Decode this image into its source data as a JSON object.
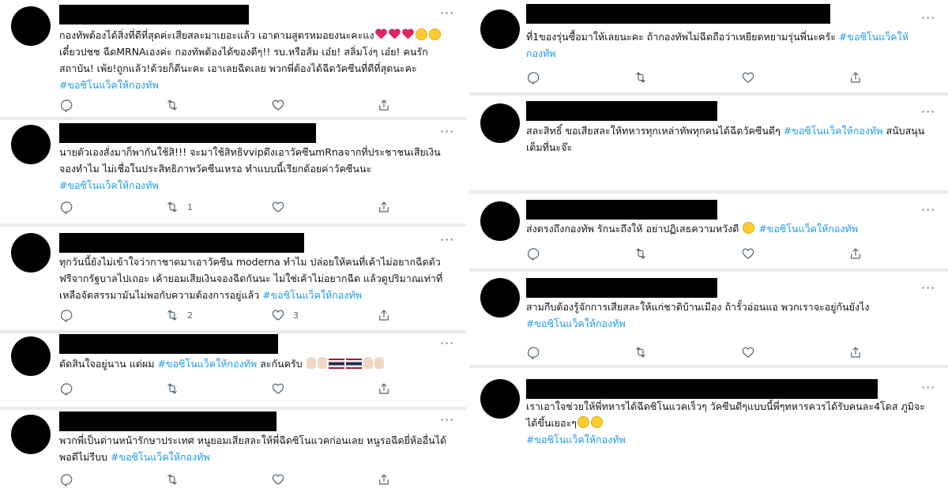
{
  "tweets_left": [
    {
      "text": "กองทัพต้องได้สิ่งที่ดีที่สุดค่ะเสียสละมาเยอะแล้ว เอาตามสูตรหมอยงนะคะแง",
      "text2": "เดี๋ยวปชช ฉีดMRNAเองค่ะ กองทัพต้องได้ของดีๆ!! รบ.หรือส้ม เอ๋ย! สลิ่มโง่ๆ เอ๋ย! คนรักสถาบัน! เพ้ย!ถูกแล้ว!ด้วยก็ดีนะคะ เอาเลยฉีดเลย พวกพี่ต้องได้ฉีดวัคซีนที่ดีที่สุดนะคะ",
      "hashtag": "#ขอซิโนแว็คให้กองทัพ",
      "reply_count": "",
      "retweet_count": "",
      "like_count": ""
    },
    {
      "text": "นายตัวเองสั่งมาก็พากันใช้สิ!!! จะมาใช้สิทธิvvipดึงเอาวัคซีนmRnaจากที่ประชาชนเสียเงินจองทำไม  ไม่เชื่อในประสิทธิภาพวัคซีนเหรอ  ทำแบบนี้เรียกด้อยค่าวัคซีนนะ",
      "hashtag": "#ขอซิโนแว็คให้กองทัพ",
      "reply_count": "",
      "retweet_count": "1",
      "like_count": ""
    },
    {
      "text": "ทุกวันนี้ยังไม่เข้าใจว่ากาชาดมาเอาวัคซีน moderna ทำไม ปล่อยให้คนที่เค้าไม่อยากฉีดตัวฟรีจากรัฐบาลไปเถอะ เค้ายอมเสียเงินจองฉีดกันนะ ไม่ใช่เค้าไม่อยากฉีด แล้วดูปริมาณเท่าที่เหลือจัดสรรมามันไม่พอกับความต้องการอยู่แล้ว",
      "hashtag": "#ขอซิโนแว็คให้กองทัพ",
      "reply_count": "",
      "retweet_count": "2",
      "like_count": "3"
    },
    {
      "text": "ตัดสินใจอยู่นาน แต่ผม",
      "hashtag": "#ขอซิโนแว็คให้กองทัพ",
      "text_after": "ละกันครับ",
      "reply_count": "",
      "retweet_count": "",
      "like_count": ""
    },
    {
      "text": "พวกพี่เป็นด่านหน้ารักษาประเทศ หนูยอมเสียสละให้พี่ฉีดซิโนแวคก่อนเลย หนูรอฉีดยี่ห้ออื่นได้ พอดีไม่รีบบ",
      "hashtag": "#ขอซิโนแว็คให้กองทัพ",
      "reply_count": "",
      "retweet_count": "",
      "like_count": ""
    }
  ],
  "tweets_right": [
    {
      "text": "ที่1ของรุ่นซื้อมาให้เลยนะคะ ถ้ากองทัพไม่ฉีดถือว่าเหยียดหยามรุ่นพี่นะครัะ",
      "hashtag": "#ขอซิโนแว็คให้กองทัพ",
      "reply_count": "",
      "retweet_count": "",
      "like_count": ""
    },
    {
      "text": "สละสิทธิ์ ขอเสียสละให้ทหารทุกเหล่าทัพทุกคนได้ฉีดวัคซีนดีๆ",
      "hashtag": "#ขอซิโนแว็คให้กองทัพ",
      "text_after": "สนับสนุนเต็มที่นะจ๊ะ",
      "reply_count": "",
      "retweet_count": "",
      "like_count": ""
    },
    {
      "text": "ส่งตรงถึงกองทัพ รักนะถึงให้ อย่าปฏิเสธความหวังดี",
      "hashtag": "#ขอซิโนแว็คให้กองทัพ",
      "reply_count": "",
      "retweet_count": "",
      "like_count": ""
    },
    {
      "text": "สามกีบต้องรู้จักการเสียสละให้แก่ชาติบ้านเมือง ถ้ารั้วอ่อนแอ พวกเราจะอยู่กันยังไง",
      "hashtag": "#ขอซิโนแว็คให้กองทัพ",
      "reply_count": "",
      "retweet_count": "",
      "like_count": ""
    },
    {
      "text": "เราเอาใจช่วยให้พี่ทหารได้ฉีดซิโนแวคเร็วๆ วัคซีนดีๆแบบนี้พี่ๆทหารควรได้รับคนละ4โดส ภูมิจะได้ขึ้นเยอะๆ",
      "hashtag": "#ขอซิโนแว็คให้กองทัพ"
    }
  ],
  "more_label": "···",
  "colors": {
    "hashtag": "#1d9bf0",
    "icon": "#536471",
    "text": "#0f1419",
    "redaction": "#000000"
  },
  "icons": [
    "reply-icon",
    "retweet-icon",
    "like-icon",
    "share-icon",
    "more-icon"
  ]
}
